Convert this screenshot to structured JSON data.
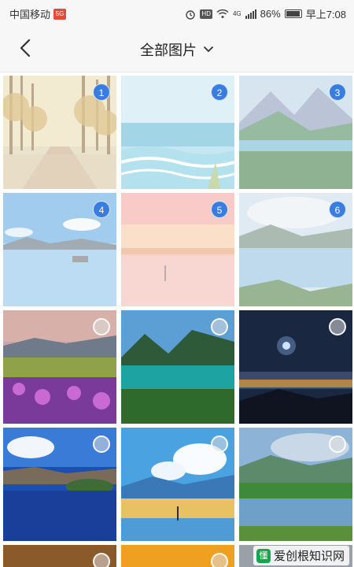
{
  "status_bar": {
    "carrier": "中国移动",
    "carrier_badge": "5G",
    "hd": "HD",
    "network": "4G",
    "battery": "86%",
    "time": "早上7:08"
  },
  "nav": {
    "back_icon": "chevron-left-icon",
    "title": "全部图片",
    "dropdown_icon": "chevron-down-icon"
  },
  "photos": [
    {
      "scene": "autumn-forest-road",
      "selected_number": "1"
    },
    {
      "scene": "sea-waves-beach",
      "selected_number": "2"
    },
    {
      "scene": "mountain-lake-valley",
      "selected_number": "3"
    },
    {
      "scene": "calm-lake-reflection",
      "selected_number": "4"
    },
    {
      "scene": "pink-sunset-lake",
      "selected_number": "5"
    },
    {
      "scene": "river-bay-clouds",
      "selected_number": "6"
    },
    {
      "scene": "purple-flower-meadow",
      "selected_number": ""
    },
    {
      "scene": "turquoise-mountain-lake",
      "selected_number": ""
    },
    {
      "scene": "night-sky-star-city",
      "selected_number": ""
    },
    {
      "scene": "crater-lake-blue",
      "selected_number": ""
    },
    {
      "scene": "anime-sky-lake",
      "selected_number": ""
    },
    {
      "scene": "green-valley-river",
      "selected_number": ""
    },
    {
      "scene": "partial-bottom-1",
      "selected_number": ""
    },
    {
      "scene": "partial-bottom-2",
      "selected_number": ""
    },
    {
      "scene": "partial-bottom-3",
      "selected_number": ""
    }
  ],
  "watermark": {
    "logo": "懂",
    "text": "爱创根知识网"
  }
}
